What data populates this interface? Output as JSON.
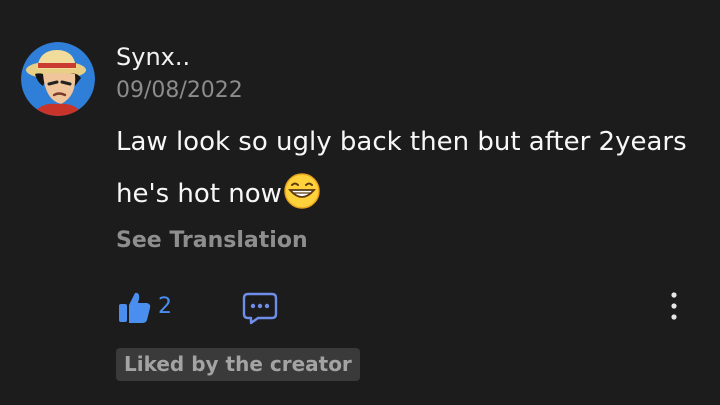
{
  "comment": {
    "username": "Synx..",
    "date": "09/08/2022",
    "text_line1": "Law look so ugly back then but after 2years",
    "text_line2": "he's hot now",
    "emoji": "grinning-squinting-face-emoji",
    "see_translation": "See Translation",
    "likes": "2",
    "creator_badge": "Liked by the creator"
  },
  "icons": {
    "avatar": "anime-character-avatar",
    "like": "thumbs-up-icon",
    "reply": "chat-bubble-icon",
    "more": "more-vertical-icon"
  },
  "colors": {
    "background": "#1c1c1c",
    "like_accent": "#4a8ff0",
    "muted_text": "#8c8c8c",
    "badge_bg": "#3a3a3a"
  }
}
